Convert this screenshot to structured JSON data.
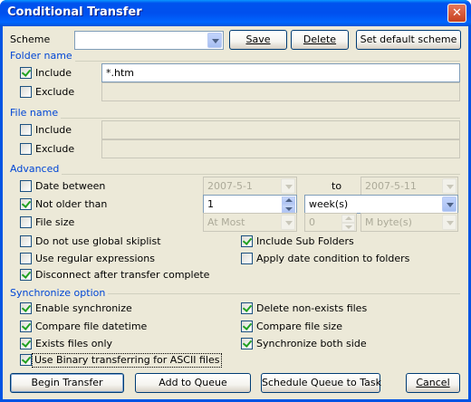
{
  "window": {
    "title": "Conditional Transfer",
    "close_glyph": "✕"
  },
  "scheme": {
    "label": "Scheme",
    "value": "",
    "save_label": "Save",
    "delete_label": "Delete",
    "set_default_label": "Set default scheme"
  },
  "folder_name": {
    "heading": "Folder name",
    "include_label": "Include",
    "include_checked": true,
    "include_value": "*.htm",
    "exclude_label": "Exclude",
    "exclude_checked": false,
    "exclude_value": ""
  },
  "file_name": {
    "heading": "File name",
    "include_label": "Include",
    "include_checked": false,
    "include_value": "",
    "exclude_label": "Exclude",
    "exclude_checked": false,
    "exclude_value": ""
  },
  "advanced": {
    "heading": "Advanced",
    "date_between_label": "Date between",
    "date_between_checked": false,
    "date_from": "2007-5-1",
    "to_label": "to",
    "date_to": "2007-5-11",
    "not_older_label": "Not older than",
    "not_older_checked": true,
    "not_older_value": "1",
    "not_older_unit": "week(s)",
    "file_size_label": "File size",
    "file_size_checked": false,
    "file_size_compare": "At Most",
    "file_size_value": "0",
    "file_size_unit": "M byte(s)",
    "no_global_skiplist_label": "Do not use global skiplist",
    "no_global_skiplist_checked": false,
    "include_subfolders_label": "Include Sub Folders",
    "include_subfolders_checked": true,
    "regex_label": "Use regular expressions",
    "regex_checked": false,
    "apply_date_folders_label": "Apply date condition to folders",
    "apply_date_folders_checked": false,
    "disconnect_label": "Disconnect after transfer complete",
    "disconnect_checked": true
  },
  "sync": {
    "heading": "Synchronize option",
    "enable_label": "Enable synchronize",
    "enable_checked": true,
    "delete_nonexist_label": "Delete non-exists files",
    "delete_nonexist_checked": true,
    "compare_datetime_label": "Compare file datetime",
    "compare_datetime_checked": true,
    "compare_size_label": "Compare file size",
    "compare_size_checked": true,
    "exists_only_label": "Exists files only",
    "exists_only_checked": true,
    "sync_both_label": "Synchronize both side",
    "sync_both_checked": true,
    "binary_ascii_label": "Use Binary transferring for ASCII files",
    "binary_ascii_checked": true
  },
  "footer": {
    "begin_label": "Begin Transfer",
    "add_queue_label": "Add to Queue",
    "schedule_label": "Schedule Queue to Task",
    "cancel_label": "Cancel"
  }
}
